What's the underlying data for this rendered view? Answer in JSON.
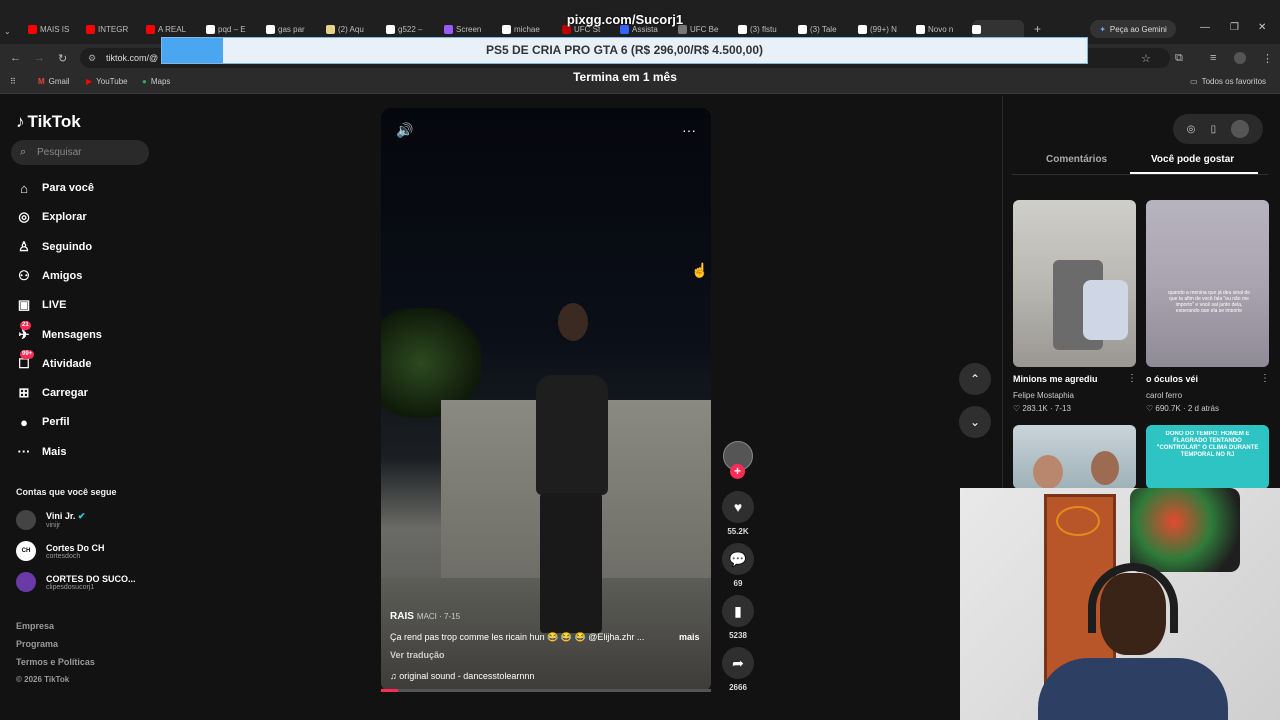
{
  "browser": {
    "tabs": [
      {
        "label": "MAIS IS",
        "icon": "youtube-icon",
        "color": "#ff0000"
      },
      {
        "label": "INTEGR",
        "icon": "youtube-icon",
        "color": "#ff0000"
      },
      {
        "label": "A REAL",
        "icon": "youtube-icon",
        "color": "#ff0000"
      },
      {
        "label": "pqd – E",
        "icon": "x-icon",
        "color": "#ffffff"
      },
      {
        "label": "gas par",
        "icon": "google-icon",
        "color": "#ffffff"
      },
      {
        "label": "(2) Aqu",
        "icon": "site-icon",
        "color": "#e8d28a"
      },
      {
        "label": "g522 –",
        "icon": "google-icon",
        "color": "#ffffff"
      },
      {
        "label": "Screen",
        "icon": "site-icon",
        "color": "#9b59ff"
      },
      {
        "label": "michae",
        "icon": "google-icon",
        "color": "#ffffff"
      },
      {
        "label": "UFC St",
        "icon": "site-icon",
        "color": "#c00000"
      },
      {
        "label": "Assista",
        "icon": "site-icon",
        "color": "#3466ff"
      },
      {
        "label": "UFC Be",
        "icon": "site-icon",
        "color": "#777777"
      },
      {
        "label": "(3) flstu",
        "icon": "x-icon",
        "color": "#ffffff"
      },
      {
        "label": "(3) Tale",
        "icon": "x-icon",
        "color": "#ffffff"
      },
      {
        "label": "(99+) N",
        "icon": "tiktok-icon",
        "color": "#ffffff"
      },
      {
        "label": "Novo n",
        "icon": "tiktok-icon",
        "color": "#ffffff"
      },
      {
        "label": "",
        "icon": "tiktok-icon",
        "color": "#ffffff"
      }
    ],
    "new_tab": "+",
    "gemini_label": "Peça ao Gemini",
    "url": "tiktok.com/@",
    "bookmarks": [
      "Gmail",
      "YouTube",
      "Maps"
    ],
    "all_bookmarks": "Todos os favoritos"
  },
  "overlay": {
    "title": "pixgg.com/Sucorj1",
    "goal_label": "PS5 DE CRIA PRO GTA 6 (R$ 296,00/R$ 4.500,00)",
    "goal_progress": 0.0658,
    "goal_color": "#4aa6f0",
    "subtitle": "Termina em 1 mês"
  },
  "tiktok": {
    "brand": "TikTok",
    "search_placeholder": "Pesquisar",
    "nav": [
      {
        "label": "Para você",
        "icon": "home-icon",
        "badge": ""
      },
      {
        "label": "Explorar",
        "icon": "compass-icon",
        "badge": ""
      },
      {
        "label": "Seguindo",
        "icon": "following-icon",
        "badge": ""
      },
      {
        "label": "Amigos",
        "icon": "friends-icon",
        "badge": ""
      },
      {
        "label": "LIVE",
        "icon": "live-icon",
        "badge": ""
      },
      {
        "label": "Mensagens",
        "icon": "messages-icon",
        "badge": "21"
      },
      {
        "label": "Atividade",
        "icon": "activity-icon",
        "badge": "99+"
      },
      {
        "label": "Carregar",
        "icon": "upload-icon",
        "badge": ""
      },
      {
        "label": "Perfil",
        "icon": "profile-icon",
        "badge": ""
      },
      {
        "label": "Mais",
        "icon": "more-icon",
        "badge": ""
      }
    ],
    "following_title": "Contas que você segue",
    "following": [
      {
        "name": "Vini Jr.",
        "handle": "vinijr",
        "avatar": "",
        "verified": true
      },
      {
        "name": "Cortes Do CH",
        "handle": "cortesdoch",
        "avatar": "CH",
        "verified": false
      },
      {
        "name": "CORTES DO SUCO...",
        "handle": "clipesdosucorj1",
        "avatar": "",
        "verified": false
      }
    ],
    "footer": [
      "Empresa",
      "Programa",
      "Termos e Políticas",
      "© 2026 TikTok"
    ],
    "video": {
      "author": "RAIS",
      "author_sub": "MACI · 7-15",
      "caption": "Ça rend pas trop comme les ricain hun 😂 😂 😂 @Elijha.zhr ...",
      "more": "mais",
      "translate": "Ver tradução",
      "sound": "original sound - dancesstolearnnn",
      "progress": 0.05
    },
    "actions": {
      "likes": "55.2K",
      "comments": "69",
      "saves": "5238",
      "shares": "2666"
    },
    "panel": {
      "tab_comments": "Comentários",
      "tab_suggested": "Você pode gostar",
      "cards": [
        {
          "title": "Minions me agrediu",
          "author": "Felipe Mostaphia",
          "likes": "283.1K",
          "date": "7-13"
        },
        {
          "title": "o óculos véi",
          "author": "carol ferro",
          "likes": "690.7K",
          "date": "2 d atrás",
          "overlay_text": "quando a menina que já deu sinal de que ta afim de você fala \"eu não me importo\" e você sai junto dela, esperando que ela se importe"
        },
        {
          "title": "",
          "author": "",
          "likes": "",
          "date": ""
        },
        {
          "title": "",
          "author": "",
          "likes": "",
          "date": "",
          "overlay_text": "DONO DO TEMPO: HOMEM É FLAGRADO TENTANDO \"CONTROLAR\" O CLIMA DURANTE TEMPORAL NO RJ"
        }
      ]
    }
  }
}
